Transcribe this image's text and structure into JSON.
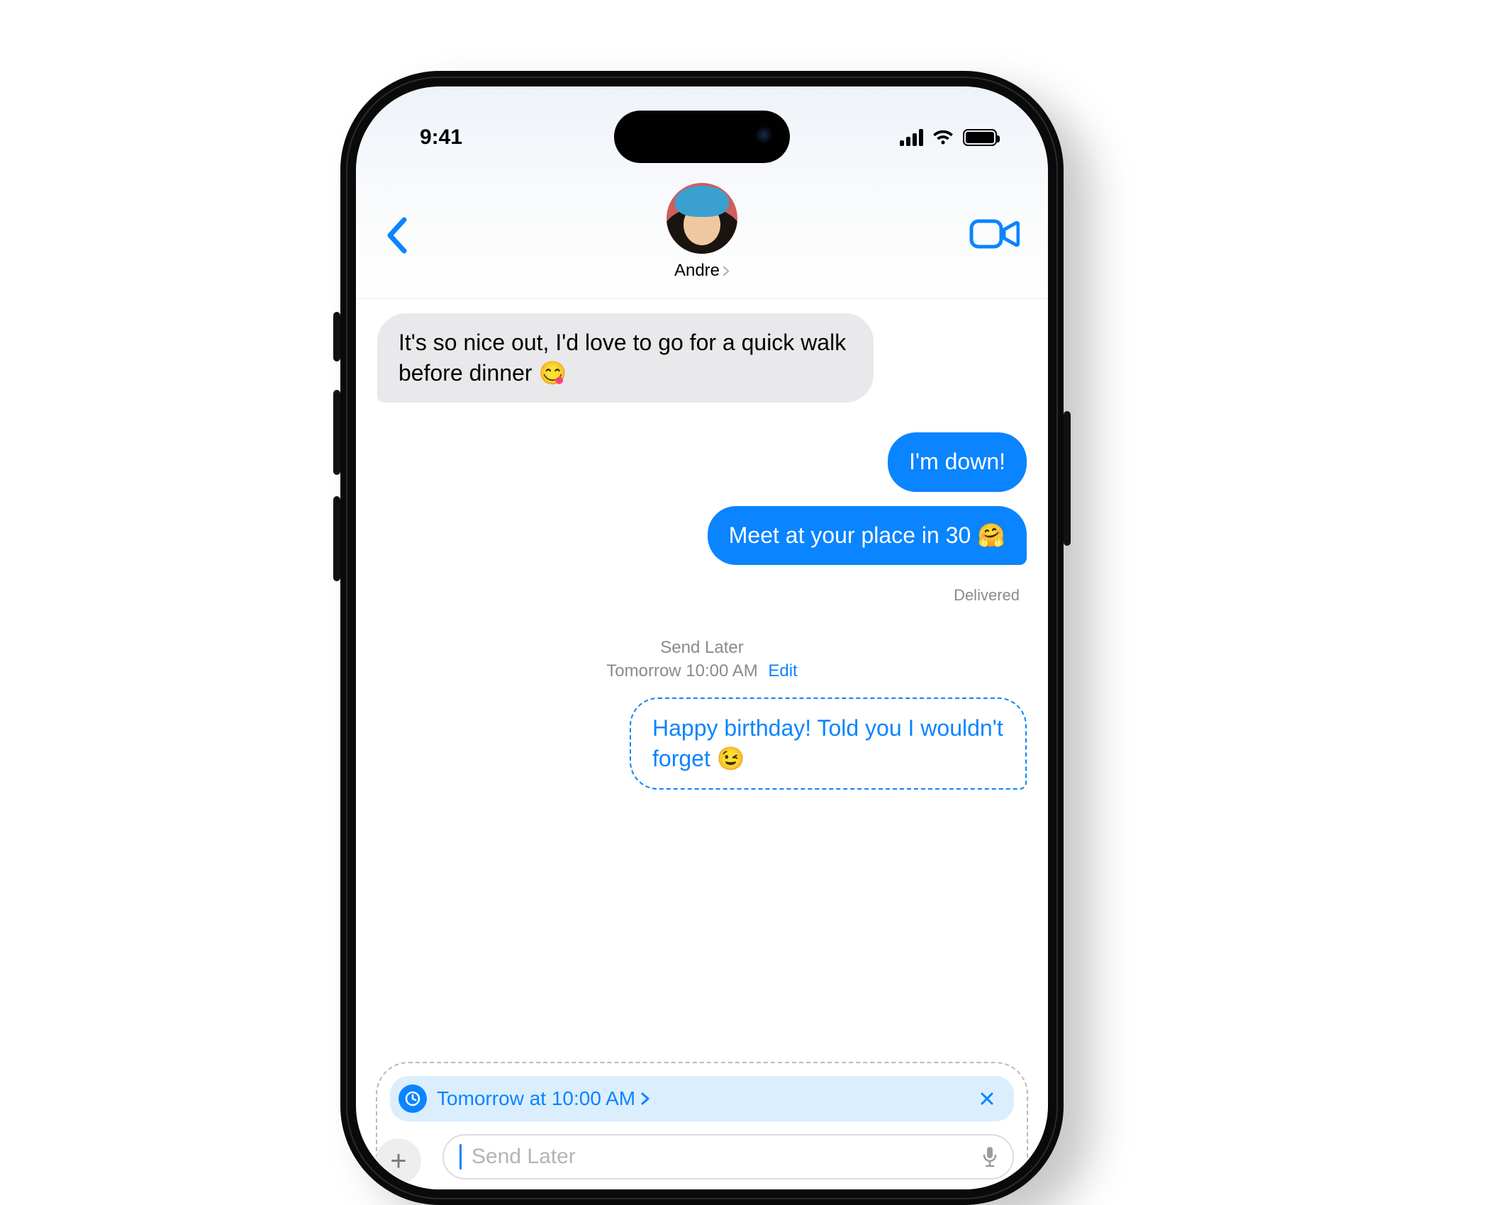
{
  "status": {
    "time": "9:41"
  },
  "header": {
    "contact_name": "Andre"
  },
  "messages": {
    "incoming_1": "It's so nice out, I'd love to go for a quick walk before dinner 😋",
    "outgoing_1": "I'm down!",
    "outgoing_2": "Meet at your place in 30 🤗",
    "delivery_status": "Delivered",
    "send_later": {
      "title": "Send Later",
      "when": "Tomorrow 10:00 AM",
      "edit_label": "Edit"
    },
    "scheduled_1": "Happy birthday! Told you I wouldn't forget 😉"
  },
  "compose": {
    "schedule_chip_label": "Tomorrow at 10:00 AM",
    "placeholder": "Send Later"
  }
}
